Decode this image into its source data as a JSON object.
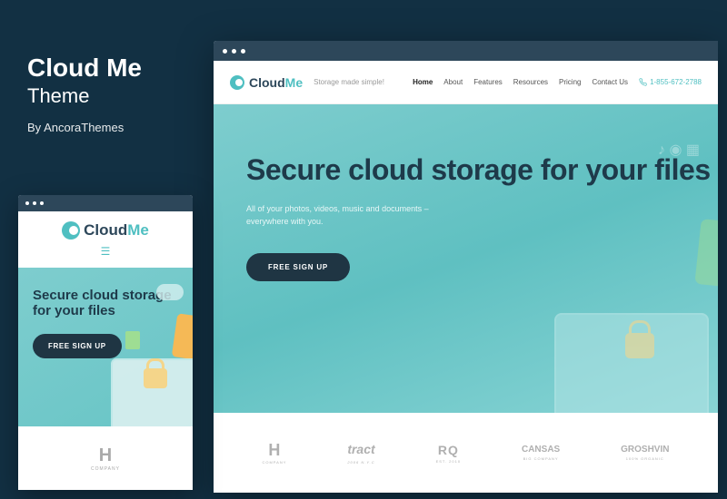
{
  "title": {
    "main": "Cloud Me",
    "sub": "Theme",
    "author": "By AncoraThemes"
  },
  "brand": {
    "name_part1": "Cloud",
    "name_part2": "Me",
    "tagline": "Storage made simple!"
  },
  "nav": {
    "items": [
      "Home",
      "About",
      "Features",
      "Resources",
      "Pricing",
      "Contact Us"
    ],
    "phone": "1-855-672-2788"
  },
  "hero": {
    "title": "Secure cloud storage for your files",
    "subtitle1": "All of your photos, videos, music and documents –",
    "subtitle2": "everywhere with you.",
    "cta": "FREE SIGN UP"
  },
  "brands": [
    {
      "main": "H",
      "sub": "COMPANY"
    },
    {
      "main": "tract",
      "sub": "2006 N.Y.C"
    },
    {
      "main": "RQ",
      "sub": "EST. 2010"
    },
    {
      "main": "CANSAS",
      "sub": "BIG COMPANY"
    },
    {
      "main": "GROSHVIN",
      "sub": "100% ORGANIC"
    }
  ],
  "mobile_brand": {
    "main": "H",
    "sub": "COMPANY"
  }
}
